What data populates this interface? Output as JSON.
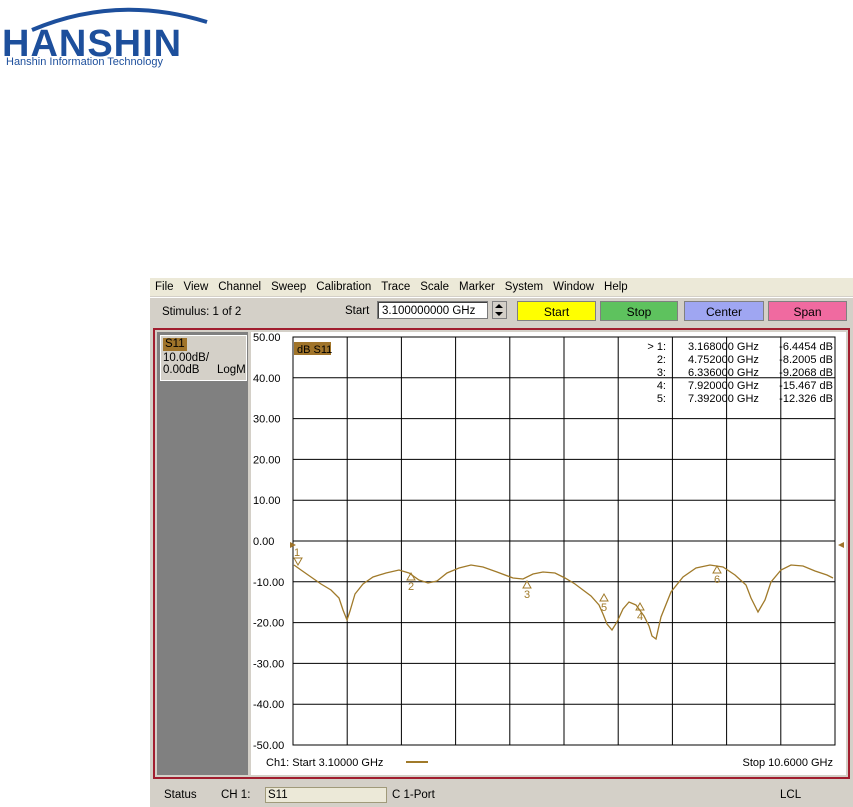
{
  "logo": {
    "word": "HANSHIN",
    "subtitle": "Hanshin Information Technology"
  },
  "menubar": [
    "File",
    "View",
    "Channel",
    "Sweep",
    "Calibration",
    "Trace",
    "Scale",
    "Marker",
    "System",
    "Window",
    "Help"
  ],
  "toolbar": {
    "stimulus": "Stimulus: 1 of 2",
    "start_label": "Start",
    "start_value": "3.100000000 GHz",
    "buttons": [
      {
        "label": "Start",
        "color": "#ffff00"
      },
      {
        "label": "Stop",
        "color": "#5ec25e"
      },
      {
        "label": "Center",
        "color": "#9fa6f2"
      },
      {
        "label": "Span",
        "color": "#f06aa0"
      }
    ]
  },
  "trace_panel": {
    "name": "S11",
    "scale": "10.00dB/",
    "ref": "0.00dB",
    "format": "LogM"
  },
  "plot": {
    "trace_label": "dB S11",
    "y_ticks": [
      "50.00",
      "40.00",
      "30.00",
      "20.00",
      "10.00",
      "0.00",
      "-10.00",
      "-20.00",
      "-30.00",
      "-40.00",
      "-50.00"
    ],
    "markers": [
      {
        "id": "> 1:",
        "freq": "3.168000 GHz",
        "value": "-6.4454 dB"
      },
      {
        "id": "2:",
        "freq": "4.752000 GHz",
        "value": "-8.2005 dB"
      },
      {
        "id": "3:",
        "freq": "6.336000 GHz",
        "value": "-9.2068 dB"
      },
      {
        "id": "4:",
        "freq": "7.920000 GHz",
        "value": "-15.467 dB"
      },
      {
        "id": "5:",
        "freq": "7.392000 GHz",
        "value": "-12.326 dB"
      }
    ],
    "marker_labels": [
      "1",
      "2",
      "3",
      "5",
      "4",
      "6"
    ],
    "footer_left": "Ch1: Start  3.10000 GHz",
    "footer_right": "Stop  10.6000 GHz",
    "trace_color": "#a07a2a"
  },
  "statusbar": {
    "status": "Status",
    "channel": "CH 1:",
    "param": "S11",
    "cal": "C  1-Port",
    "lcl": "LCL"
  }
}
